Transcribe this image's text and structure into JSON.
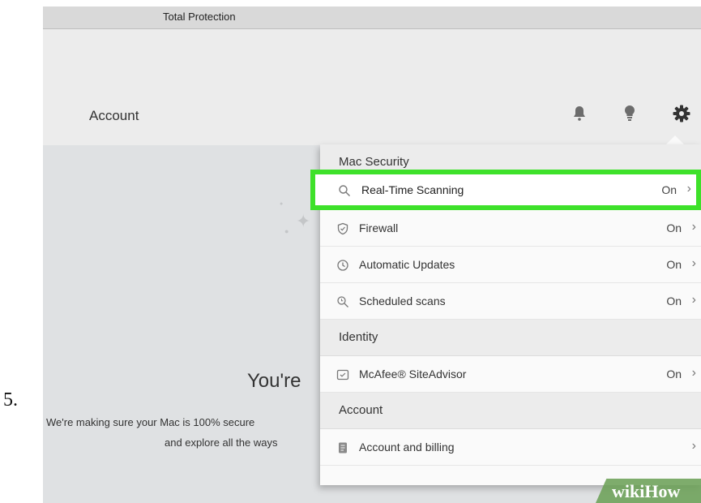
{
  "step_number": "5.",
  "window": {
    "title": "Total Protection"
  },
  "header": {
    "account_label": "Account",
    "icons": [
      "bell-icon",
      "lightbulb-icon",
      "gear-icon"
    ]
  },
  "background": {
    "headline": "You're",
    "subtext_line1": "We're making sure your Mac is 100% secure",
    "subtext_line2": "and explore all the ways"
  },
  "menu": {
    "sections": [
      {
        "title": "Mac Security",
        "items": [
          {
            "icon": "search-icon",
            "label": "Real-Time Scanning",
            "value": "On",
            "highlighted": true
          },
          {
            "icon": "shield-icon",
            "label": "Firewall",
            "value": "On"
          },
          {
            "icon": "clock-icon",
            "label": "Automatic Updates",
            "value": "On"
          },
          {
            "icon": "scan-icon",
            "label": "Scheduled scans",
            "value": "On"
          }
        ]
      },
      {
        "title": "Identity",
        "items": [
          {
            "icon": "siteadvisor-icon",
            "label": "McAfee® SiteAdvisor",
            "value": "On"
          }
        ]
      },
      {
        "title": "Account",
        "items": [
          {
            "icon": "billing-icon",
            "label": "Account and billing",
            "value": ""
          }
        ]
      }
    ]
  },
  "watermark": "wikiHow",
  "colors": {
    "highlight": "#3ee12a",
    "watermark": "#6ca058"
  }
}
